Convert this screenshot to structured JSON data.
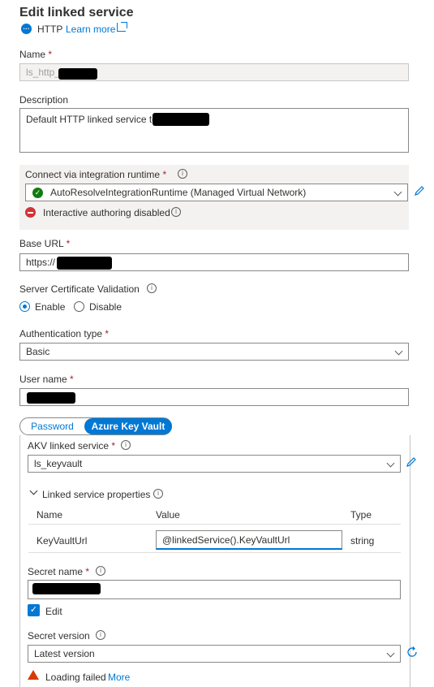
{
  "header": {
    "title": "Edit linked service",
    "type_label": "HTTP",
    "learn_more": "Learn more"
  },
  "name": {
    "label": "Name",
    "required": "*",
    "value": "ls_http_"
  },
  "description": {
    "label": "Description",
    "value": "Default HTTP linked service to"
  },
  "integration_runtime": {
    "label": "Connect via integration runtime",
    "required": "*",
    "value": "AutoResolveIntegrationRuntime (Managed Virtual Network)",
    "status": "Interactive authoring disabled"
  },
  "base_url": {
    "label": "Base URL",
    "required": "*",
    "value": "https://"
  },
  "cert_validation": {
    "label": "Server Certificate Validation",
    "options": [
      "Enable",
      "Disable"
    ],
    "selected": "Enable"
  },
  "auth_type": {
    "label": "Authentication type",
    "required": "*",
    "value": "Basic"
  },
  "user_name": {
    "label": "User name",
    "required": "*",
    "value": ""
  },
  "credential_tabs": {
    "password": "Password",
    "akv": "Azure Key Vault",
    "selected": "Azure Key Vault"
  },
  "akv": {
    "linked_service_label": "AKV linked service",
    "required": "*",
    "linked_service_value": "ls_keyvault",
    "properties_label": "Linked service properties",
    "table": {
      "headers": [
        "Name",
        "Value",
        "Type"
      ],
      "rows": [
        {
          "name": "KeyVaultUrl",
          "value": "@linkedService().KeyVaultUrl",
          "type": "string"
        }
      ]
    },
    "secret_name_label": "Secret name",
    "secret_name_value": "",
    "edit_label": "Edit",
    "secret_version_label": "Secret version",
    "secret_version_value": "Latest version",
    "loading_failed": "Loading failed",
    "more": "More"
  },
  "colors": {
    "accent": "#0078d4",
    "error": "#d13438",
    "success": "#107c10",
    "warning": "#d83b01"
  }
}
